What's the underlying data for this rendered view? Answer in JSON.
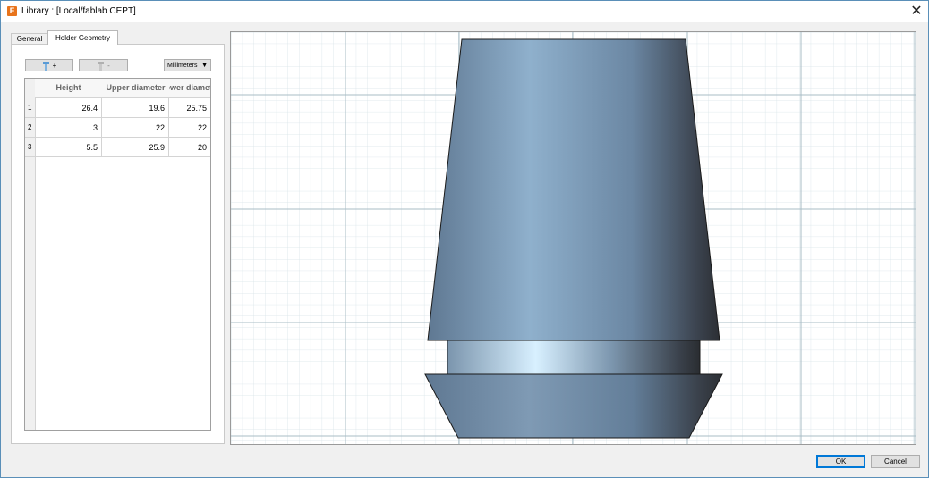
{
  "window": {
    "title": "Library : [Local/fablab CEPT]",
    "app_icon_letter": "F"
  },
  "tabs": [
    {
      "label": "General"
    },
    {
      "label": "Holder Geometry"
    }
  ],
  "toolbar": {
    "add_label": "+",
    "remove_label": "-",
    "units": "Millimeters"
  },
  "table": {
    "columns": [
      "Height",
      "Upper diameter",
      "Lower diameter"
    ],
    "rows": [
      {
        "index": "1",
        "height": "26.4",
        "upper": "19.6",
        "lower": "25.75"
      },
      {
        "index": "2",
        "height": "3",
        "upper": "22",
        "lower": "22"
      },
      {
        "index": "3",
        "height": "5.5",
        "upper": "25.9",
        "lower": "20"
      }
    ]
  },
  "dialog": {
    "ok_label": "OK",
    "cancel_label": "Cancel"
  },
  "colors": {
    "accent": "#0078d7",
    "holder_body": "#7f9ab4",
    "grid_minor": "#d8e4e8",
    "grid_major": "#a9bcc6"
  }
}
